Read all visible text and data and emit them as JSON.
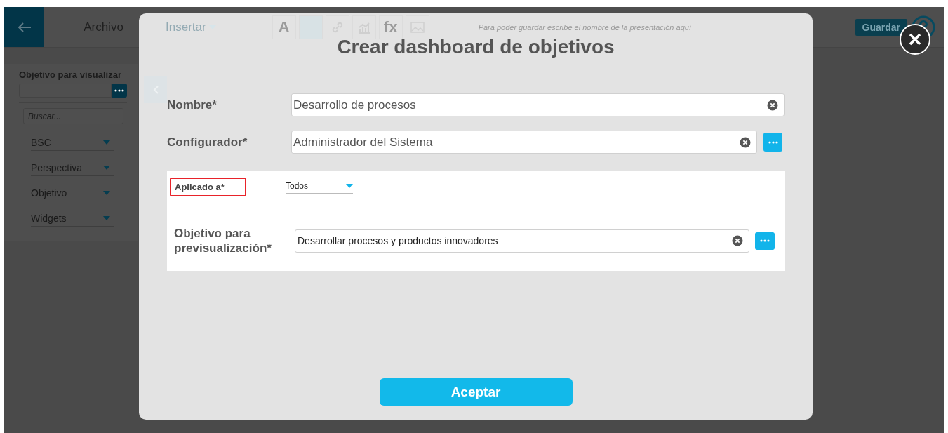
{
  "app_bar": {
    "menu": "Archivo",
    "insert_menu": "Insertar",
    "toolbar_glyphs": [
      "A",
      "fx"
    ],
    "title_placeholder": "Para poder guardar escribe el nombre de la presentación aquí",
    "save_button": "Guardar"
  },
  "sidebar": {
    "title": "Objetivo para visualizar",
    "search_placeholder": "Buscar...",
    "filters": [
      "BSC",
      "Perspectiva",
      "Objetivo",
      "Widgets"
    ]
  },
  "dialog": {
    "title": "Crear dashboard de objetivos",
    "fields": [
      {
        "label": "Nombre*",
        "value": "Desarrollo de procesos",
        "kind": "text"
      },
      {
        "label": "Configurador*",
        "value": "Administrador del Sistema",
        "kind": "lookup"
      }
    ],
    "panel": {
      "applied_label": "Aplicado a*",
      "highlighted": true,
      "applied_value": "Todos",
      "preview_label": "Objetivo para previsualización*",
      "preview_value": "Desarrollar procesos y productos innovadores"
    },
    "accept_button": "Aceptar"
  }
}
